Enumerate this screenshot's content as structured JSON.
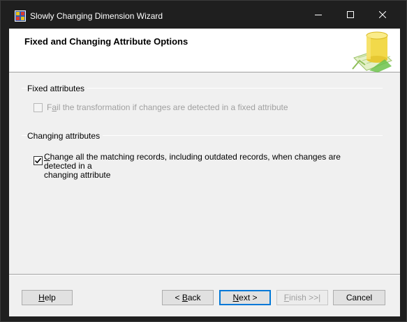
{
  "window": {
    "title": "Slowly Changing Dimension Wizard"
  },
  "header": {
    "title": "Fixed and Changing Attribute Options"
  },
  "fixed_attributes": {
    "label": "Fixed attributes",
    "checkbox_label_first": "F",
    "checkbox_label_access": "a",
    "checkbox_label_rest": "il the transformation if changes are detected in a fixed attribute",
    "checked": false,
    "enabled": false
  },
  "changing_attributes": {
    "label": "Changing attributes",
    "checkbox_label_access": "C",
    "checkbox_label_line1_rest": "hange all the matching records, including outdated records, when changes are detected in a",
    "checkbox_label_line2": "changing attribute",
    "checked": true,
    "enabled": true
  },
  "buttons": {
    "help": {
      "access": "H",
      "rest": "elp"
    },
    "back": {
      "prefix": "< ",
      "access": "B",
      "rest": "ack"
    },
    "next": {
      "access": "N",
      "rest": "ext >"
    },
    "finish": {
      "access": "F",
      "rest": "inish >>|"
    },
    "cancel": "Cancel"
  },
  "icons": {
    "app": "wizard-app-icon",
    "minimize": "minimize-icon",
    "maximize": "maximize-icon",
    "close": "close-icon",
    "header_graphic": "database-dimension-icon",
    "checkmark": "checkmark-icon"
  },
  "colors": {
    "title_bar": "#1f1f1f",
    "dialog_bg": "#f0f0f0",
    "default_button_border": "#0078d7",
    "disabled_text": "#a0a0a0"
  }
}
